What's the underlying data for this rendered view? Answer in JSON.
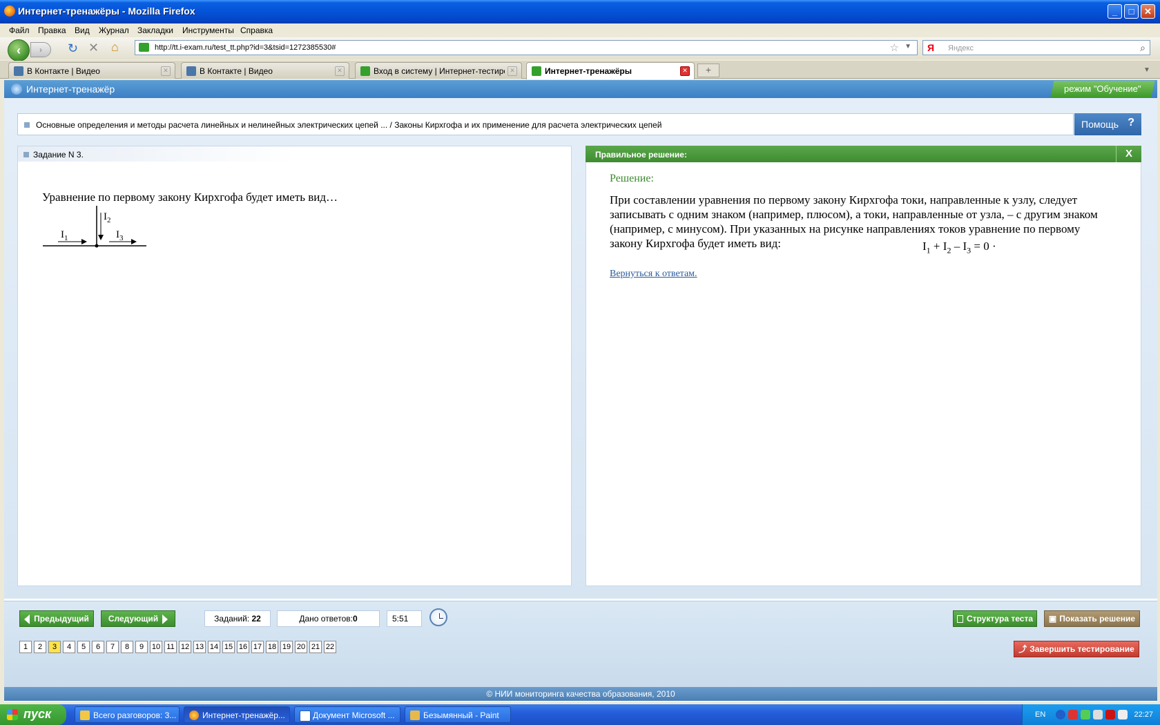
{
  "window": {
    "title": "Интернет-тренажёры - Mozilla Firefox"
  },
  "menu": [
    "Файл",
    "Правка",
    "Вид",
    "Журнал",
    "Закладки",
    "Инструменты",
    "Справка"
  ],
  "nav": {
    "url": "http://tt.i-exam.ru/test_tt.php?id=3&tsid=1272385530#",
    "search_placeholder": "Яндекс",
    "search_logo": "Я"
  },
  "tabs": [
    {
      "label": "В Контакте | Видео",
      "icon": "vk-icon"
    },
    {
      "label": "В Контакте | Видео",
      "icon": "vk-icon"
    },
    {
      "label": "Вход в систему | Интернет-тестиров...",
      "icon": "iexam-icon"
    },
    {
      "label": "Интернет-тренажёры",
      "icon": "iexam-icon"
    }
  ],
  "app": {
    "title": "Интернет-тренажёр",
    "mode": "режим \"Обучение\"",
    "breadcrumb": "Основные определения и методы расчета линейных и нелинейных электрических цепей ... / Законы Кирхгофа и их применение для расчета электрических цепей",
    "help": "Помощь",
    "help_icon": "?"
  },
  "task": {
    "header": "Задание N 3.",
    "question": "Уравнение по первому закону Кирхгофа будет иметь вид…",
    "diagram": {
      "i1": "I",
      "i1_sub": "1",
      "i2": "I",
      "i2_sub": "2",
      "i3": "I",
      "i3_sub": "3"
    }
  },
  "solution": {
    "header": "Правильное решение:",
    "close": "X",
    "title": "Решение:",
    "text": "При составлении уравнения по первому закону Кирхгофа токи, направленные к узлу, следует записывать с одним знаком (например, плюсом), а токи, направленные от узла, – с другим знаком (например, с минусом). При указанных на рисунке направлениях токов уравнение по первому закону Кирхгофа будет иметь вид:",
    "formula": {
      "a": "I",
      "a_sub": "1",
      "op1": " + ",
      "b": "I",
      "b_sub": "2",
      "op2": " – ",
      "c": "I",
      "c_sub": "3",
      "rest": " = 0 ·"
    },
    "back_link": "Вернуться к ответам."
  },
  "controls": {
    "prev": "Предыдущий",
    "next": "Следующий",
    "tasks_label": "Заданий:",
    "tasks_count": "22",
    "answers_label": "Дано ответов:",
    "answers_count": "0",
    "timer": "5:51",
    "structure": "Структура теста",
    "show_solution": "Показать решение",
    "finish": "Завершить тестирование",
    "pages": [
      "1",
      "2",
      "3",
      "4",
      "5",
      "6",
      "7",
      "8",
      "9",
      "10",
      "11",
      "12",
      "13",
      "14",
      "15",
      "16",
      "17",
      "18",
      "19",
      "20",
      "21",
      "22"
    ],
    "current_page": "3"
  },
  "footer": "© НИИ мониторинга качества образования, 2010",
  "taskbar": {
    "start": "пуск",
    "items": [
      {
        "label": "Всего разговоров: 3..."
      },
      {
        "label": "Интернет-тренажёр..."
      },
      {
        "label": "Документ Microsoft ..."
      },
      {
        "label": "Безымянный - Paint"
      }
    ],
    "lang": "EN",
    "time": "22:27"
  },
  "colors": {
    "accent_green": "#3f8c31",
    "header_blue": "#3c7fc4",
    "link": "#2a5b9c",
    "finish_red": "#c23b2f"
  }
}
